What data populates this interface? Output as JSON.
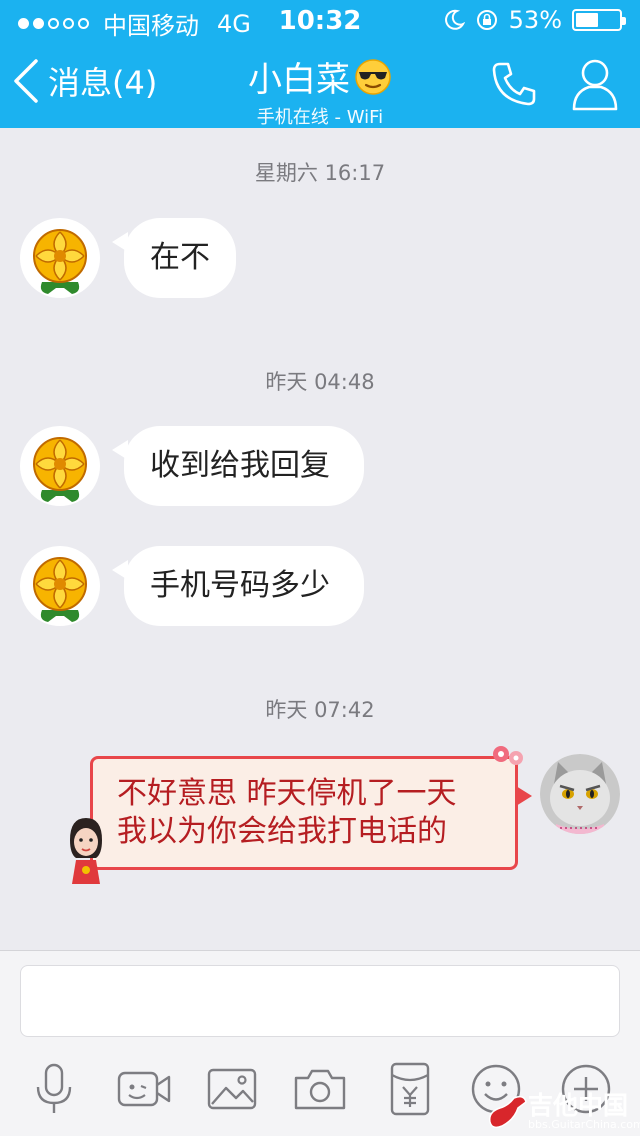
{
  "status_bar": {
    "carrier": "中国移动",
    "network": "4G",
    "time": "10:32",
    "battery_percent": "53%",
    "battery_level": 0.53
  },
  "nav": {
    "back_label": "消息(4)",
    "title": "小白菜",
    "subtitle": "手机在线 - WiFi"
  },
  "messages": [
    {
      "timestamp": "星期六 16:17",
      "text": "在不"
    },
    {
      "timestamp": "昨天 04:48",
      "text": "收到给我回复"
    },
    {
      "text": "手机号码多少"
    },
    {
      "timestamp": "昨天 07:42",
      "lines": [
        "不好意思 昨天停机了一天",
        "我以为你会给我打电话的"
      ]
    }
  ],
  "input": {
    "value": ""
  },
  "watermark": {
    "title": "吉他中国",
    "url": "bbs.GuitarChina.com"
  },
  "colors": {
    "header": "#1bb2f0",
    "background": "#ebebf0",
    "sent_text": "#b51d21",
    "sent_border": "#e8464a"
  }
}
